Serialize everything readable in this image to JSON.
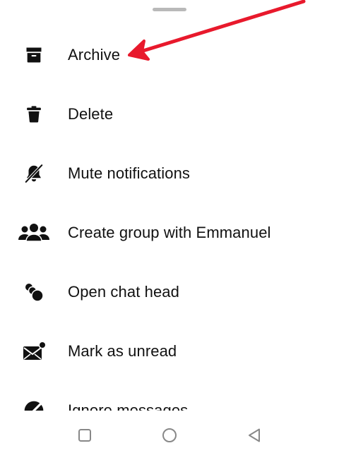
{
  "menu": {
    "items": [
      {
        "label": "Archive",
        "icon": "archive-icon"
      },
      {
        "label": "Delete",
        "icon": "trash-icon"
      },
      {
        "label": "Mute notifications",
        "icon": "bell-off-icon"
      },
      {
        "label": "Create group with Emmanuel",
        "icon": "group-icon"
      },
      {
        "label": "Open chat head",
        "icon": "chat-head-icon"
      },
      {
        "label": "Mark as unread",
        "icon": "mail-unread-icon"
      },
      {
        "label": "Ignore messages",
        "icon": "ignore-icon"
      }
    ]
  },
  "annotation": {
    "color": "#e8192c",
    "points_to": "Archive"
  },
  "nav": {
    "buttons": [
      {
        "icon": "square-recents-icon"
      },
      {
        "icon": "circle-home-icon"
      },
      {
        "icon": "triangle-back-icon"
      }
    ]
  }
}
